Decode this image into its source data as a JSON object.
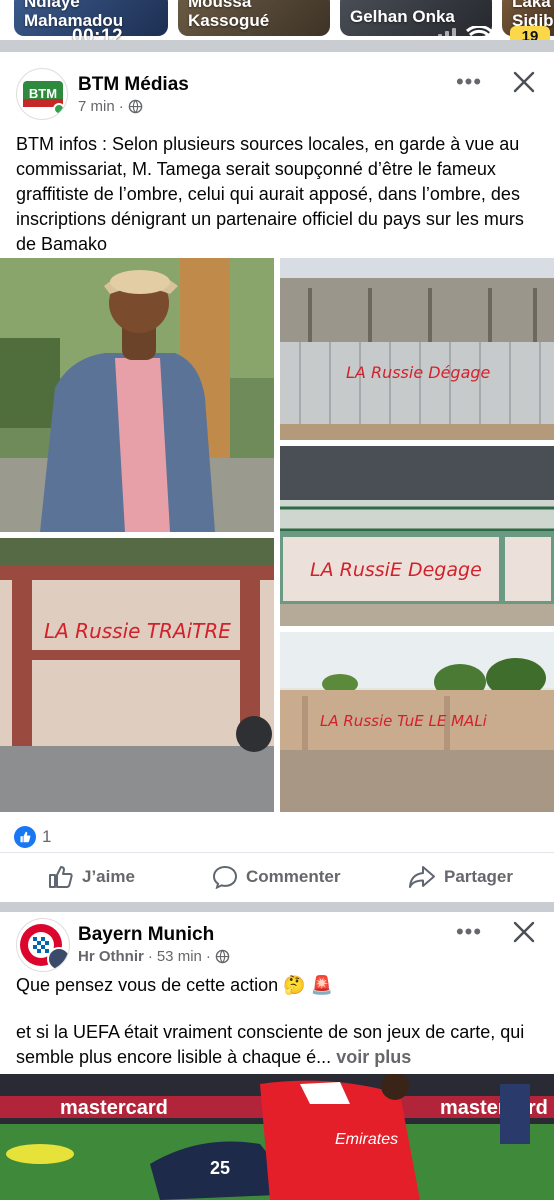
{
  "status_bar": {
    "time": "00:12",
    "battery": "19"
  },
  "stories": [
    {
      "name": "Ndiaye\nMahamadou"
    },
    {
      "name": "Moussa\nKassogué"
    },
    {
      "name": "Gelhan Onka"
    },
    {
      "name": "Laka\nSidib"
    }
  ],
  "post1": {
    "author": "BTM Médias",
    "avatar_text": "BTM",
    "time": "7 min",
    "text": "BTM infos : Selon plusieurs sources locales, en garde à vue au commissariat, M. Tamega serait soupçonné d’être le fameux graffitiste de l’ombre, celui qui aurait apposé, dans l’ombre, des inscriptions dénigrant un partenaire officiel du pays sur les murs de Bamako",
    "photos": {
      "wall1_text": "LA Russie Dégage",
      "wall2_text": "LA Russie TRAiTRE",
      "wall3_text": "LA RussiE Degage",
      "wall4_text": "LA Russie TuE LE MALi"
    },
    "reaction_count": "1",
    "actions": {
      "like": "J’aime",
      "comment": "Commenter",
      "share": "Partager"
    }
  },
  "post2": {
    "author": "Bayern Munich",
    "sub_author": "Hr Othnir",
    "time": "53 min",
    "text_line1": "Que pensez vous de cette action 🤔 🚨",
    "text_line2": "et si la UEFA était vraiment consciente de son jeux de carte, qui semble plus encore lisible à chaque é...",
    "see_more": "voir plus",
    "banner_text": "mastercard",
    "jersey_text": "Emirates",
    "jersey_number": "25"
  },
  "colors": {
    "accent": "#1877f2",
    "secondary_text": "#65676b",
    "graffiti": "#d3212c"
  }
}
